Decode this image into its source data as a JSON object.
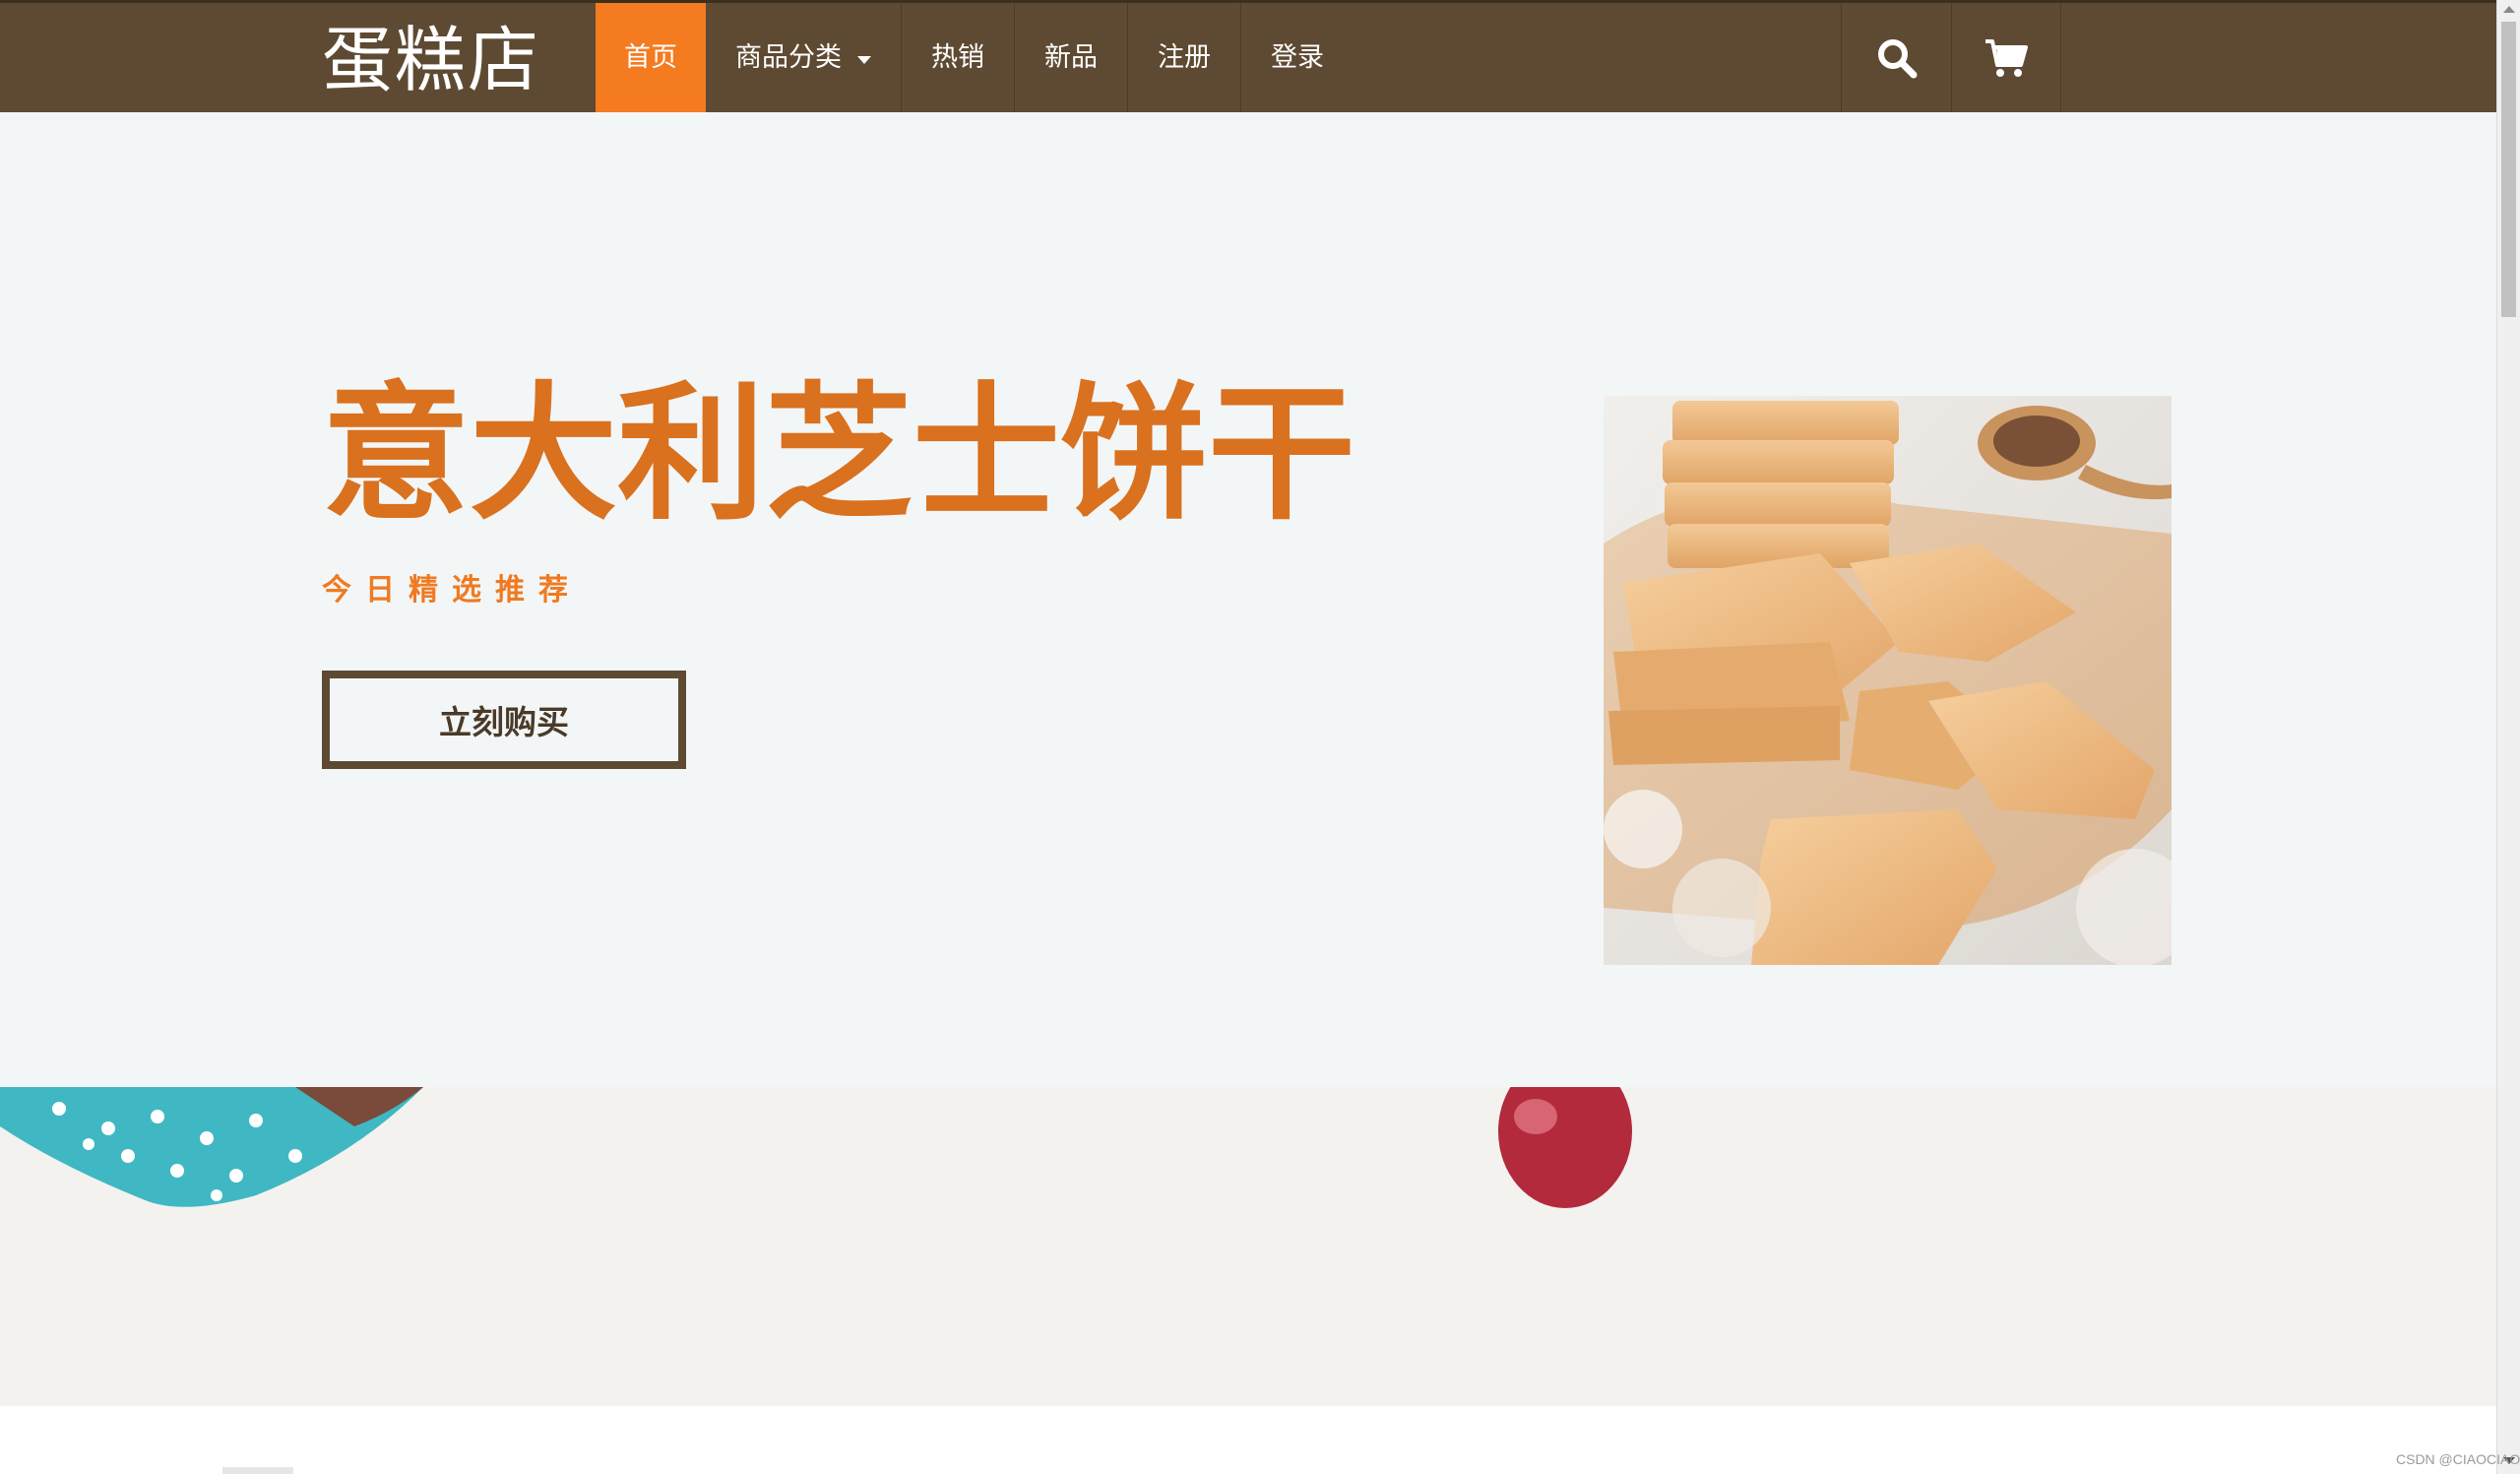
{
  "brand": {
    "name": "蛋糕店"
  },
  "nav": {
    "items": [
      {
        "label": "首页",
        "active": true
      },
      {
        "label": "商品分类",
        "has_dropdown": true
      },
      {
        "label": "热销"
      },
      {
        "label": "新品"
      },
      {
        "label": "注册"
      },
      {
        "label": "登录"
      }
    ],
    "icons": [
      "search-icon",
      "cart-icon"
    ]
  },
  "hero": {
    "title": "意大利芝士饼干",
    "subtitle": "今日精选推荐",
    "button_label": "立刻购买"
  },
  "watermark": {
    "text": "CSDN @CIAOCIAO"
  },
  "colors": {
    "navbar": "#5e4a32",
    "accent": "#f47b20",
    "title": "#d9711f",
    "hero_bg": "#f3f6f7",
    "band_bg": "#f3f2ef"
  }
}
